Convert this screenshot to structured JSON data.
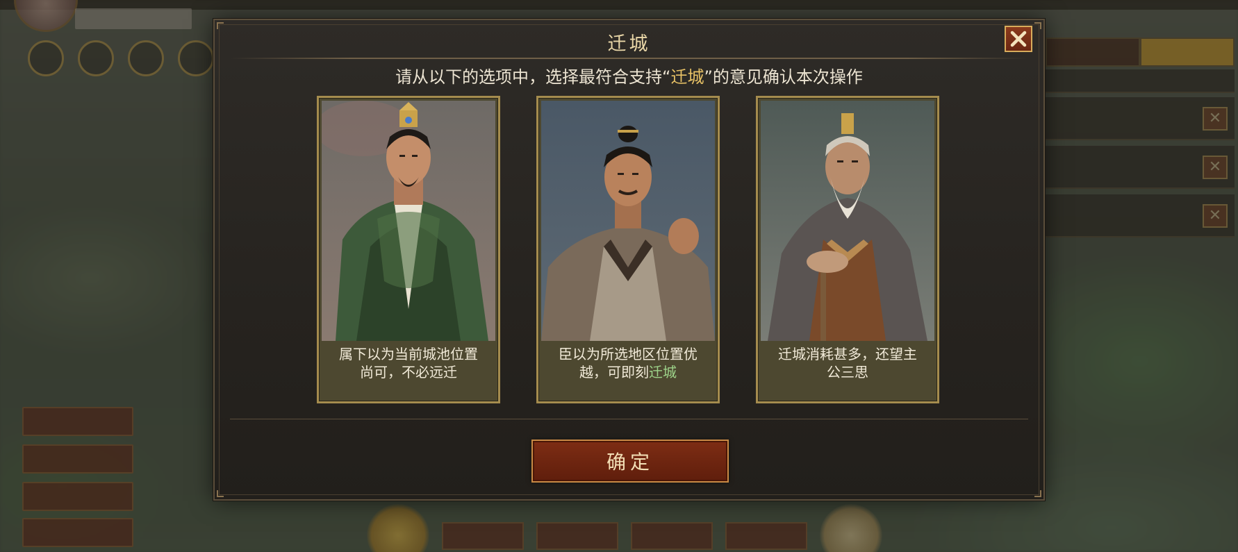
{
  "dialog": {
    "title": "迁城",
    "instruction_prefix": "请从以下的选项中，选择最符合支持“",
    "instruction_highlight": "迁城",
    "instruction_suffix": "”的意见确认本次操作",
    "confirm_label": "确定",
    "close_icon": "close-x-icon"
  },
  "options": [
    {
      "portrait": "advisor-green-robe-portrait",
      "caption_line1": "属下以为当前城池位置",
      "caption_line2": "尚可，不必远迁"
    },
    {
      "portrait": "official-gray-robe-portrait",
      "caption_line1": "臣以为所选地区位置优",
      "caption_line2_prefix": "越，可即刻",
      "caption_line2_highlight": "迁城"
    },
    {
      "portrait": "elder-with-cane-portrait",
      "caption_line1": "迁城消耗甚多，还望主",
      "caption_line2": "公三思"
    }
  ],
  "colors": {
    "highlight_gold": "#e8c266",
    "highlight_green": "#9ed48a",
    "button_red": "#7e2d14",
    "frame_gold": "#a58c4e"
  }
}
